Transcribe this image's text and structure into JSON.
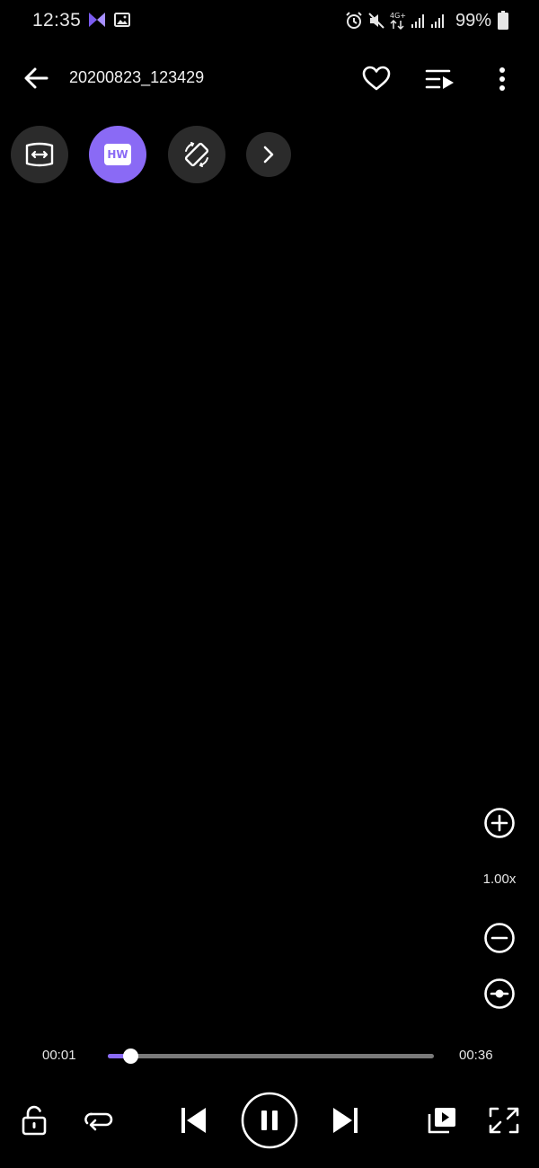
{
  "status_bar": {
    "time": "12:35",
    "battery": "99%",
    "icons": [
      "app-icon",
      "gallery-icon",
      "alarm-icon",
      "mute-icon",
      "4g-icon",
      "signal-icon",
      "signal-icon",
      "battery-icon"
    ]
  },
  "header": {
    "title": "20200823_123429",
    "actions": [
      "favorite-icon",
      "playlist-icon",
      "more-options-icon"
    ]
  },
  "quick_buttons": {
    "hw_label": "HW",
    "items": [
      "aspect-ratio-icon",
      "hw-decoder-icon",
      "rotate-screen-icon",
      "chevron-right-icon"
    ]
  },
  "zoom": {
    "level": "1.00x"
  },
  "playback": {
    "elapsed": "00:01",
    "total": "00:36",
    "progress": 0.069
  },
  "controls": [
    "unlock-icon",
    "repeat-icon",
    "previous-icon",
    "pause-icon",
    "next-icon",
    "popup-play-icon",
    "fullscreen-icon"
  ],
  "colors": {
    "accent": "#8a6af5",
    "background": "#000000",
    "button_bg": "#2b2b2b"
  }
}
